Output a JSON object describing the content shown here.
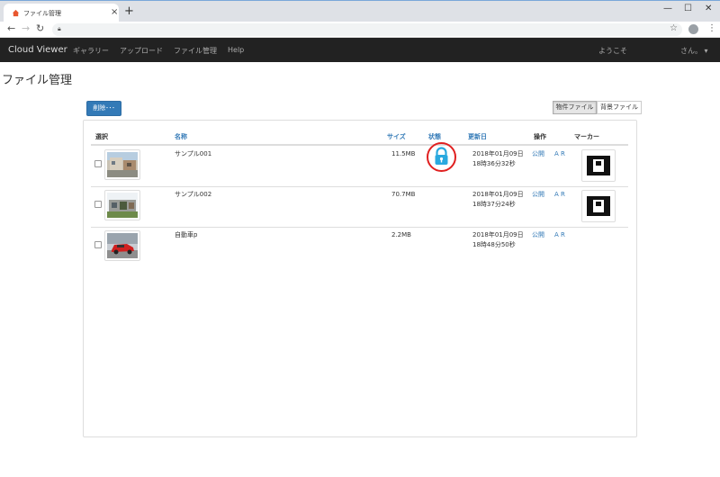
{
  "browser": {
    "tab_title": "ファイル管理",
    "new_tab": "+",
    "close_tab": "×"
  },
  "navbar": {
    "brand": "Cloud Viewer",
    "links": [
      "ギャラリー",
      "アップロード",
      "ファイル管理",
      "Help"
    ],
    "welcome": "ようこそ",
    "user": "さん。 ▾"
  },
  "page": {
    "title": "ファイル管理",
    "delete_button": "削除･･･",
    "filters": [
      "物件ファイル",
      "背景ファイル"
    ]
  },
  "table": {
    "headers": {
      "select": "選択",
      "name": "名称",
      "size": "サイズ",
      "status": "状態",
      "updated": "更新日",
      "actions": "操作",
      "marker": "マーカー"
    },
    "rows": [
      {
        "name": "サンプル001",
        "size": "11.5MB",
        "date": "2018年01月09日",
        "time": "18時36分32秒",
        "public": "公開",
        "ar": "A R",
        "locked": true,
        "has_marker": true
      },
      {
        "name": "サンプル002",
        "size": "70.7MB",
        "date": "2018年01月09日",
        "time": "18時37分24秒",
        "public": "公開",
        "ar": "A R",
        "locked": false,
        "has_marker": true
      },
      {
        "name": "自動車p",
        "size": "2.2MB",
        "date": "2018年01月09日",
        "time": "18時48分50秒",
        "public": "公開",
        "ar": "A R",
        "locked": false,
        "has_marker": false
      }
    ]
  },
  "colors": {
    "navbar_bg": "#222222",
    "link": "#337ab7",
    "primary": "#337ab7",
    "lock_icon": "#29a9df",
    "highlight_circle": "#e02020"
  }
}
